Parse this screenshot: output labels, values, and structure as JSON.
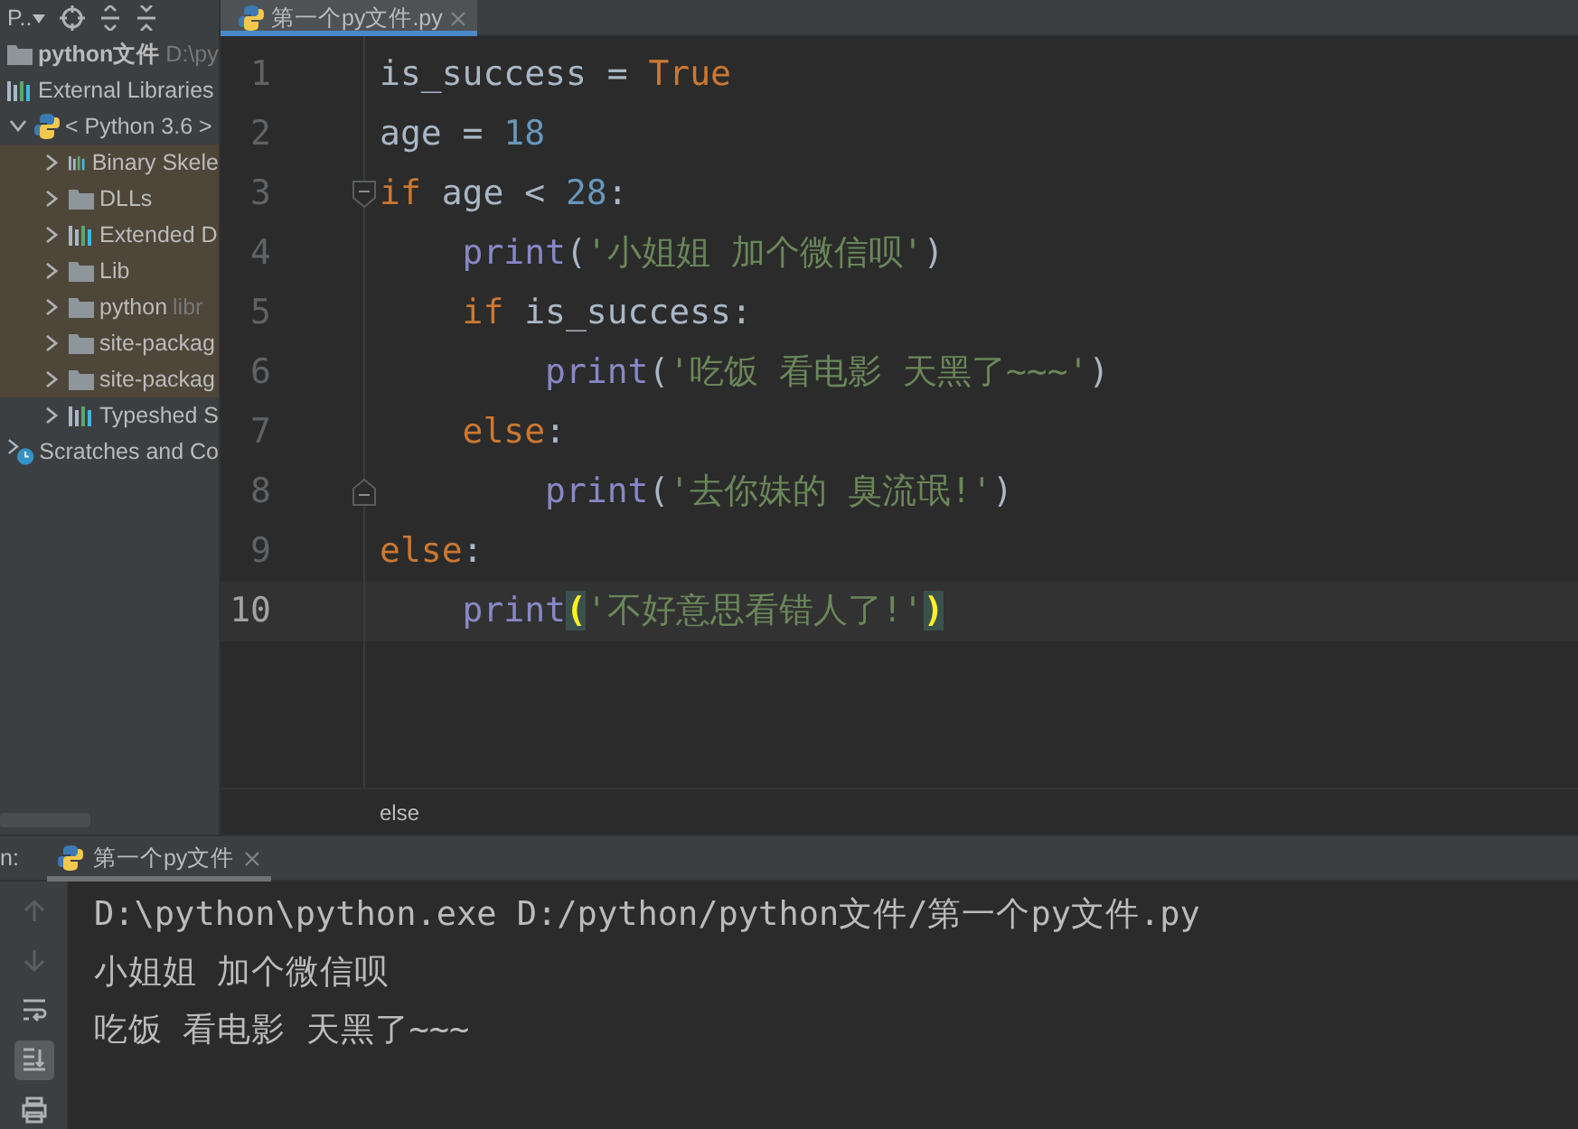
{
  "project_toolbar": {
    "view_label": "P.."
  },
  "project_tree": [
    {
      "label": "python文件",
      "hint": "D:\\py",
      "kind": "project",
      "highlighted": false
    },
    {
      "label": "External Libraries",
      "kind": "library",
      "highlighted": false
    },
    {
      "label": "< Python 3.6 >",
      "kind": "python",
      "expanded": true,
      "highlighted": false,
      "children": [
        {
          "label": "Binary Skele",
          "kind": "library",
          "expanded": false,
          "highlighted": true
        },
        {
          "label": "DLLs",
          "kind": "folder",
          "expanded": false,
          "highlighted": true
        },
        {
          "label": "Extended D",
          "kind": "library",
          "expanded": false,
          "highlighted": true
        },
        {
          "label": "Lib",
          "kind": "folder",
          "expanded": false,
          "highlighted": true
        },
        {
          "label": "python",
          "hint": "libr",
          "kind": "folder",
          "expanded": false,
          "highlighted": true
        },
        {
          "label": "site-packag",
          "kind": "folder",
          "expanded": false,
          "highlighted": true
        },
        {
          "label": "site-packag",
          "kind": "folder",
          "expanded": false,
          "highlighted": true
        },
        {
          "label": "Typeshed S",
          "kind": "library",
          "expanded": false,
          "highlighted": false
        }
      ]
    },
    {
      "label": "Scratches and Co",
      "kind": "scratches",
      "highlighted": false
    }
  ],
  "editor_tabs": [
    {
      "label": "第一个py文件.py",
      "selected": true
    }
  ],
  "code_lines": [
    {
      "number": "1",
      "current": false,
      "tokens": [
        {
          "kind": "plain",
          "text": "is_success = "
        },
        {
          "kind": "keyword",
          "text": "True"
        }
      ]
    },
    {
      "number": "2",
      "current": false,
      "tokens": [
        {
          "kind": "plain",
          "text": "age = "
        },
        {
          "kind": "number",
          "text": "18"
        }
      ]
    },
    {
      "number": "3",
      "current": false,
      "fold_open": true,
      "tokens": [
        {
          "kind": "keyword",
          "text": "if"
        },
        {
          "kind": "plain",
          "text": " age < "
        },
        {
          "kind": "number",
          "text": "28"
        },
        {
          "kind": "plain",
          "text": ":"
        }
      ]
    },
    {
      "number": "4",
      "current": false,
      "tokens": [
        {
          "kind": "builtin",
          "text": "    print"
        },
        {
          "kind": "plain",
          "text": "("
        },
        {
          "kind": "string",
          "text": "'小姐姐 加个微信呗'"
        },
        {
          "kind": "plain",
          "text": ")"
        }
      ]
    },
    {
      "number": "5",
      "current": false,
      "tokens": [
        {
          "kind": "keyword",
          "text": "    if"
        },
        {
          "kind": "plain",
          "text": " is_success:"
        }
      ]
    },
    {
      "number": "6",
      "current": false,
      "tokens": [
        {
          "kind": "builtin",
          "text": "        print"
        },
        {
          "kind": "plain",
          "text": "("
        },
        {
          "kind": "string",
          "text": "'吃饭 看电影 天黑了~~~'"
        },
        {
          "kind": "plain",
          "text": ")"
        }
      ]
    },
    {
      "number": "7",
      "current": false,
      "tokens": [
        {
          "kind": "keyword",
          "text": "    else"
        },
        {
          "kind": "plain",
          "text": ":"
        }
      ]
    },
    {
      "number": "8",
      "current": false,
      "fold_close": true,
      "tokens": [
        {
          "kind": "builtin",
          "text": "        print"
        },
        {
          "kind": "plain",
          "text": "("
        },
        {
          "kind": "string",
          "text": "'去你妹的 臭流氓!'"
        },
        {
          "kind": "plain",
          "text": ")"
        }
      ]
    },
    {
      "number": "9",
      "current": false,
      "tokens": [
        {
          "kind": "keyword",
          "text": "else"
        },
        {
          "kind": "plain",
          "text": ":"
        }
      ]
    },
    {
      "number": "10",
      "current": true,
      "tokens": [
        {
          "kind": "builtin",
          "text": "    print"
        },
        {
          "kind": "brace",
          "text": "("
        },
        {
          "kind": "string",
          "text": "'不好意思看错人了!'"
        },
        {
          "kind": "brace",
          "text": ")"
        }
      ]
    }
  ],
  "breadcrumb": "else",
  "run_panel": {
    "label": "n:",
    "tabs": [
      {
        "label": "第一个py文件",
        "selected": true
      }
    ],
    "tools": [
      {
        "kind": "up",
        "disabled": true,
        "selected": false
      },
      {
        "kind": "down",
        "disabled": true,
        "selected": false
      },
      {
        "kind": "wrap",
        "disabled": false,
        "selected": false
      },
      {
        "kind": "scroll-end",
        "disabled": false,
        "selected": true
      },
      {
        "kind": "print",
        "disabled": false,
        "selected": false
      }
    ],
    "output": [
      "D:\\python\\python.exe D:/python/python文件/第一个py文件.py",
      "小姐姐 加个微信呗",
      "吃饭 看电影 天黑了~~~"
    ]
  }
}
